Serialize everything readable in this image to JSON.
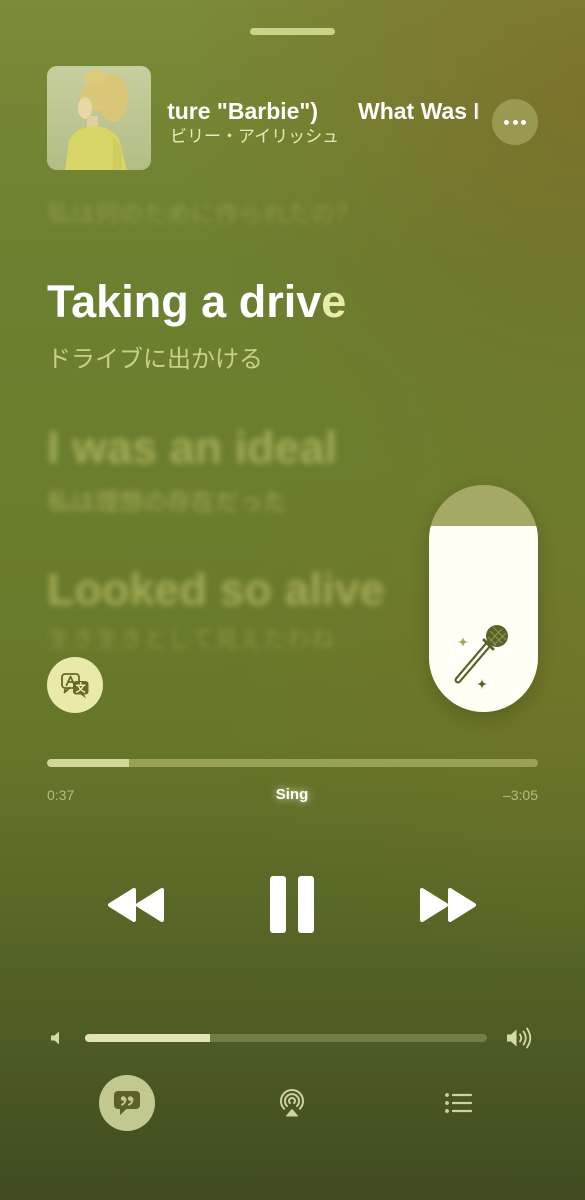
{
  "now_playing": {
    "title_fragment_1": "ture \"Barbie\")",
    "title_fragment_2": "What Was I",
    "artist": "ビリー・アイリッシュ",
    "more_icon": "ellipsis-icon"
  },
  "lyrics": {
    "previous_translation": "私は何のために作られたの？",
    "current": {
      "sung": "Taking a driv",
      "upcoming": "e",
      "translation": "ドライブに出かける"
    },
    "upcoming_lines": [
      {
        "line": "I was an ideal",
        "translation": "私は理想の存在だった"
      },
      {
        "line": "Looked so alive",
        "translation": "生き生きとして見えたわね"
      }
    ]
  },
  "translate_button": {
    "icon": "translate-icon"
  },
  "sing_control": {
    "vocal_level": 0.82,
    "icon": "microphone-sparkles-icon"
  },
  "playback": {
    "elapsed": "0:37",
    "remaining": "–3:05",
    "mode_label": "Sing",
    "progress": 0.167
  },
  "transport": {
    "rewind_icon": "backward-icon",
    "pause_icon": "pause-icon",
    "forward_icon": "forward-icon"
  },
  "volume": {
    "level": 0.31,
    "min_icon": "speaker-icon",
    "max_icon": "speaker-wave-icon"
  },
  "bottom_bar": {
    "lyrics_icon": "lyrics-quote-icon",
    "lyrics_active": true,
    "airplay_icon": "airplay-icon",
    "queue_icon": "list-icon"
  },
  "colors": {
    "accent_pale": "#e8eca8",
    "translation_text": "#c9cf8c",
    "progress_fill": "#d4d79c",
    "slider_track": "#a6a865",
    "icon_dark": "#5d6128"
  }
}
